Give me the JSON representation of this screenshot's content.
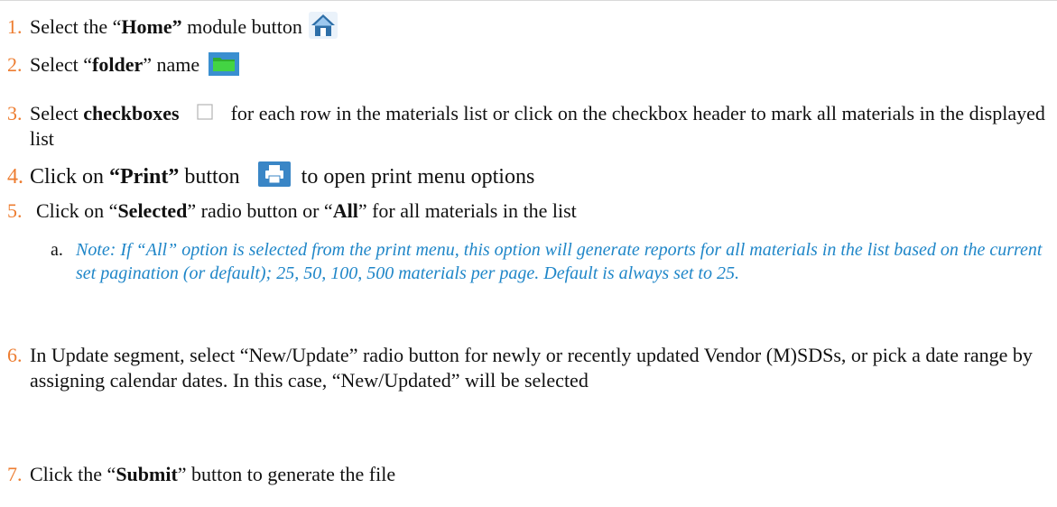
{
  "steps": [
    {
      "num": "1.",
      "pre": "Select the “",
      "bold": "Home”",
      "post": " module button",
      "icon": "home-icon"
    },
    {
      "num": "2.",
      "pre": "Select “",
      "bold": "folder",
      "post": "” name",
      "icon": "folder-icon"
    },
    {
      "num": "3.",
      "pre": "Select ",
      "bold": "checkboxes",
      "post": " for each row in the materials list or click on the checkbox header to mark all materials in the displayed list",
      "icon": "checkbox-icon"
    },
    {
      "num": "4.",
      "pre": "Click on ",
      "bold": "“Print”",
      "post": " button",
      "post2": " to open print menu options",
      "icon": "print-icon"
    },
    {
      "num": "5.",
      "pre": "Click on “",
      "bold": "Selected",
      "mid": "” radio button or “",
      "bold2": "All",
      "post": "” for all materials in the list"
    },
    {
      "num": "6.",
      "text": "In Update segment, select “New/Update” radio button for newly or recently updated Vendor (M)SDSs, or pick a date range by assigning calendar dates. In this case, “New/Updated” will be selected"
    },
    {
      "num": "7.",
      "pre": "Click the “",
      "bold": "Submit",
      "post": "” button to generate the file"
    }
  ],
  "note": {
    "label": "a.",
    "text": "Note: If “All” option is selected from the print menu, this option will generate reports for all materials in the list based on the current set pagination (or default); 25, 50, 100, 500 materials per page. Default is always set to 25."
  },
  "colors": {
    "number": "#ED7D31",
    "note": "#1f86c8",
    "home_icon": "#2e6fa8",
    "folder_icon": "#3fcf3f",
    "print_icon": "#3a86c6"
  }
}
